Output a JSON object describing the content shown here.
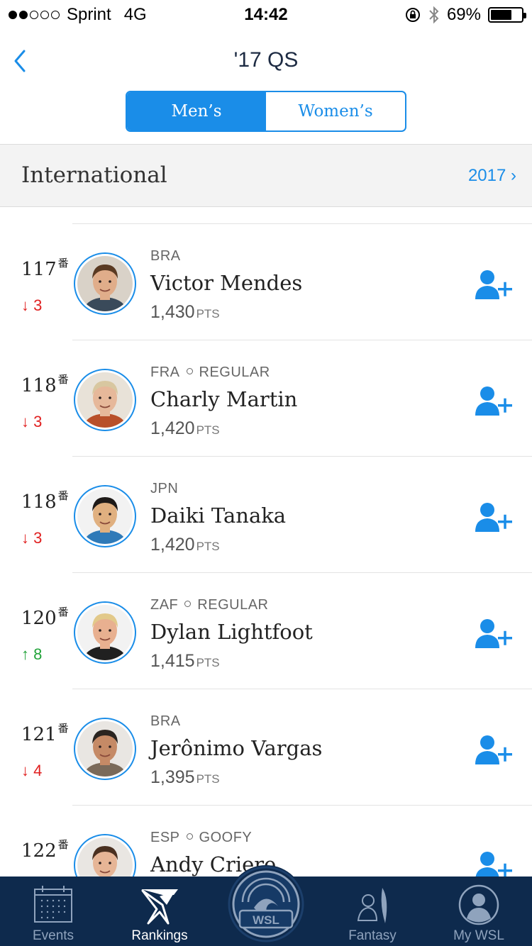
{
  "status_bar": {
    "carrier": "Sprint",
    "network": "4G",
    "time": "14:42",
    "battery": "69%",
    "battery_level": 0.69,
    "signal_bars": 2
  },
  "nav": {
    "title": "'17 QS",
    "back_icon": "chevron-left-icon",
    "segments": [
      {
        "label": "Men’s",
        "active": true
      },
      {
        "label": "Women’s",
        "active": false
      }
    ]
  },
  "section": {
    "title": "International",
    "year": "2017 ›"
  },
  "rankings": [
    {
      "rank": "117",
      "suffix": "番",
      "change": "↓ 3",
      "direction": "down",
      "meta": [
        "BRA"
      ],
      "name": "Victor Mendes",
      "points": "1,430",
      "points_unit": "PTS"
    },
    {
      "rank": "118",
      "suffix": "番",
      "change": "↓ 3",
      "direction": "down",
      "meta": [
        "FRA",
        "REGULAR"
      ],
      "name": "Charly Martin",
      "points": "1,420",
      "points_unit": "PTS"
    },
    {
      "rank": "118",
      "suffix": "番",
      "change": "↓ 3",
      "direction": "down",
      "meta": [
        "JPN"
      ],
      "name": "Daiki Tanaka",
      "points": "1,420",
      "points_unit": "PTS"
    },
    {
      "rank": "120",
      "suffix": "番",
      "change": "↑ 8",
      "direction": "up",
      "meta": [
        "ZAF",
        "REGULAR"
      ],
      "name": "Dylan Lightfoot",
      "points": "1,415",
      "points_unit": "PTS"
    },
    {
      "rank": "121",
      "suffix": "番",
      "change": "↓ 4",
      "direction": "down",
      "meta": [
        "BRA"
      ],
      "name": "Jerônimo Vargas",
      "points": "1,395",
      "points_unit": "PTS"
    },
    {
      "rank": "122",
      "suffix": "番",
      "change": "",
      "direction": "down",
      "meta": [
        "ESP",
        "GOOFY"
      ],
      "name": "Andy Criere",
      "points": "",
      "points_unit": ""
    }
  ],
  "tabbar": {
    "tabs": [
      {
        "label": "Events",
        "icon": "calendar-icon",
        "active": false
      },
      {
        "label": "Rankings",
        "icon": "rankings-icon",
        "active": true
      },
      {
        "label": "",
        "icon": "wsl-logo-icon",
        "active": false
      },
      {
        "label": "Fantasy",
        "icon": "fantasy-icon",
        "active": false
      },
      {
        "label": "My WSL",
        "icon": "profile-icon",
        "active": false
      }
    ],
    "logo_text": "WSL"
  },
  "colors": {
    "accent": "#1a8de8",
    "tabbar_bg": "#0e2a4d",
    "down": "#e02020",
    "up": "#22a33a"
  }
}
